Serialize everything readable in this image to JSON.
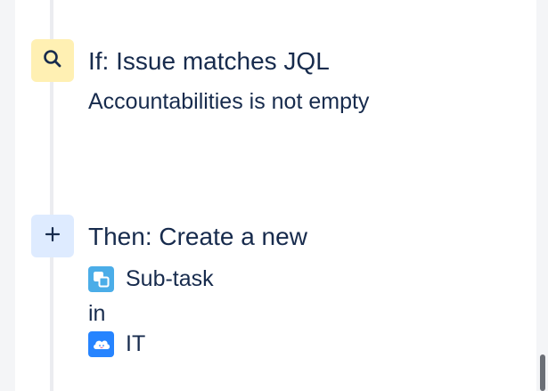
{
  "condition": {
    "icon": "search-icon",
    "title": "If: Issue matches JQL",
    "description": "Accountabilities is not empty"
  },
  "action": {
    "icon": "plus-icon",
    "title": "Then: Create a new",
    "issue_type": {
      "icon": "subtask-icon",
      "label": "Sub-task"
    },
    "connector": "in",
    "project": {
      "icon": "cloud-project-icon",
      "label": "IT"
    }
  },
  "colors": {
    "condition_icon_bg": "#fff0b3",
    "action_icon_bg": "#deebff",
    "subtask_badge": "#4bade8",
    "project_badge": "#2684ff",
    "text": "#172b4d"
  }
}
